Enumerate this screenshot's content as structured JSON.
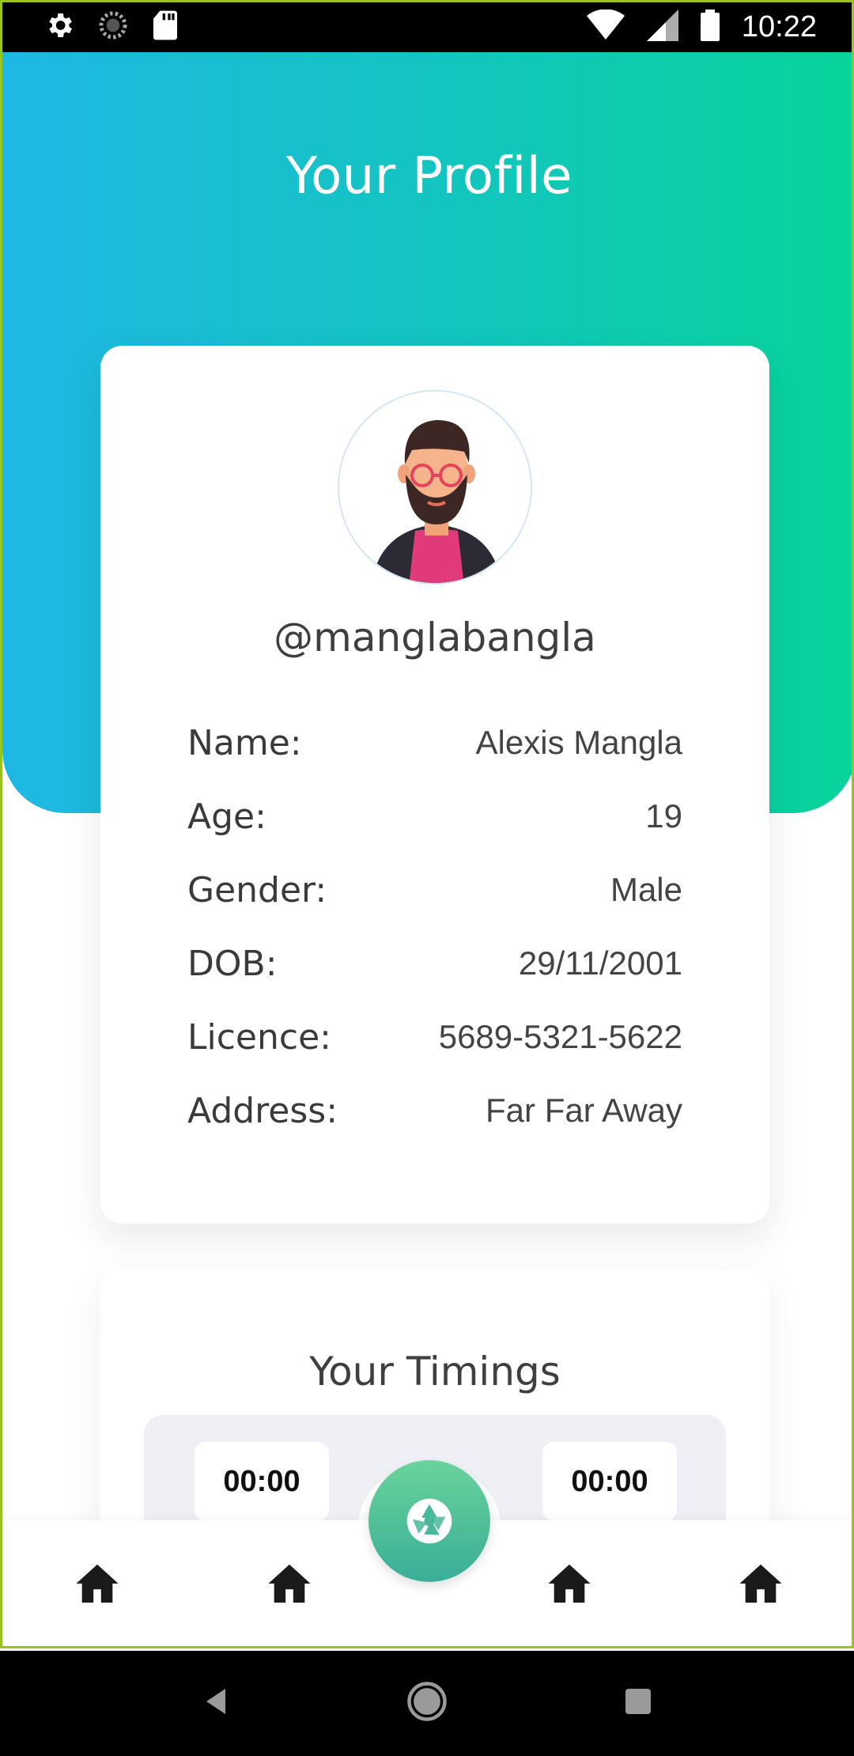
{
  "status_bar": {
    "time": "10:22",
    "left_icons": [
      "gear-icon",
      "loading-icon",
      "sd-card-icon"
    ],
    "right_icons": [
      "wifi-icon",
      "signal-icon",
      "battery-icon"
    ]
  },
  "page": {
    "title": "Your Profile",
    "gradient": [
      "#1fb7e4",
      "#08d49a"
    ]
  },
  "profile": {
    "username": "@manglabangla",
    "fields": [
      {
        "label": "Name:",
        "value": "Alexis Mangla"
      },
      {
        "label": "Age:",
        "value": "19"
      },
      {
        "label": "Gender:",
        "value": "Male"
      },
      {
        "label": "DOB:",
        "value": "29/11/2001"
      },
      {
        "label": "Licence:",
        "value": "5689-5321-5622"
      },
      {
        "label": "Address:",
        "value": "Far Far Away"
      }
    ]
  },
  "timings": {
    "title": "Your Timings",
    "start": "00:00",
    "end": "00:00"
  },
  "bottom_nav": {
    "items": [
      "home-icon",
      "home-icon",
      "home-icon",
      "home-icon"
    ],
    "fab_icon": "camera-shutter-icon",
    "fab_color": "#4cc09a"
  },
  "system_nav": [
    "back-icon",
    "home-circle-icon",
    "recents-icon"
  ]
}
